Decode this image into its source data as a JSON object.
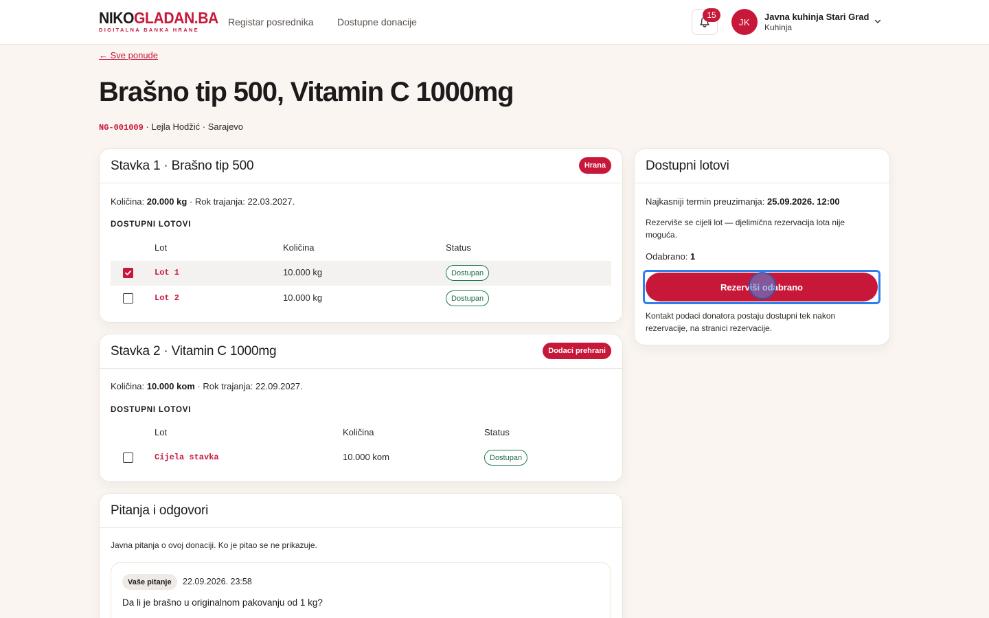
{
  "brand": {
    "logo_main_a": "NIKO",
    "logo_main_b": "GLADAN.BA",
    "logo_tagline": "DIGITALNA BANKA HRANE"
  },
  "nav": {
    "items": [
      "Registar posrednika",
      "Dostupne donacije"
    ]
  },
  "notifications": {
    "count": "15",
    "icon": "bell-icon"
  },
  "user": {
    "initials": "JK",
    "name": "Javna kuhinja Stari Grad",
    "role": "Kuhinja"
  },
  "page": {
    "back_link": "← Sve ponude",
    "title": "Brašno tip 500, Vitamin C 1000mg",
    "code": "NG-001009",
    "meta_rest": " · Lejla Hodžić · Sarajevo"
  },
  "items": [
    {
      "title": "Stavka 1 · Brašno tip 500",
      "category": "Hrana",
      "quantity_label": "Količina: ",
      "quantity_value": "20.000 kg",
      "expiry": " · Rok trajanja: 22.03.2027.",
      "section_label": "DOSTUPNI LOTOVI",
      "headers": [
        "Lot",
        "Količina",
        "Status"
      ],
      "lots": [
        {
          "code": "Lot 1",
          "qty": "10.000 kg",
          "status": "Dostupan",
          "checked": true
        },
        {
          "code": "Lot 2",
          "qty": "10.000 kg",
          "status": "Dostupan",
          "checked": false
        }
      ]
    },
    {
      "title": "Stavka 2 · Vitamin C 1000mg",
      "category": "Dodaci prehrani",
      "quantity_label": "Količina: ",
      "quantity_value": "10.000 kom",
      "expiry": " · Rok trajanja: 22.09.2027.",
      "section_label": "DOSTUPNI LOTOVI",
      "headers": [
        "Lot",
        "Količina",
        "Status"
      ],
      "lots": [
        {
          "code": "Cijela stavka",
          "qty": "10.000 kom",
          "status": "Dostupan",
          "checked": false
        }
      ]
    }
  ],
  "sidebar": {
    "title": "Dostupni lotovi",
    "deadline_label": "Najkasniji termin preuzimanja: ",
    "deadline_value": "25.09.2026. 12:00",
    "note": "Rezerviše se cijeli lot — djelimična rezervacija lota nije moguća.",
    "selected_label": "Odabrano: ",
    "selected_value": "1",
    "reserve_button": "Rezerviši odabrano",
    "contact_note": "Kontakt podaci donatora postaju dostupni tek nakon rezervacije, na stranici rezervacije."
  },
  "qa": {
    "title": "Pitanja i odgovori",
    "intro": "Javna pitanja o ovoj donaciji. Ko je pitao se ne prikazuje.",
    "question": {
      "badge": "Vaše pitanje",
      "timestamp": "22.09.2026. 23:58",
      "text": "Da li je brašno u originalnom pakovanju od 1 kg?"
    }
  },
  "colors": {
    "accent": "#c8183a",
    "status_green": "#1e7a4a",
    "focus_blue": "#2f7ef0",
    "background": "#faf5f0"
  }
}
